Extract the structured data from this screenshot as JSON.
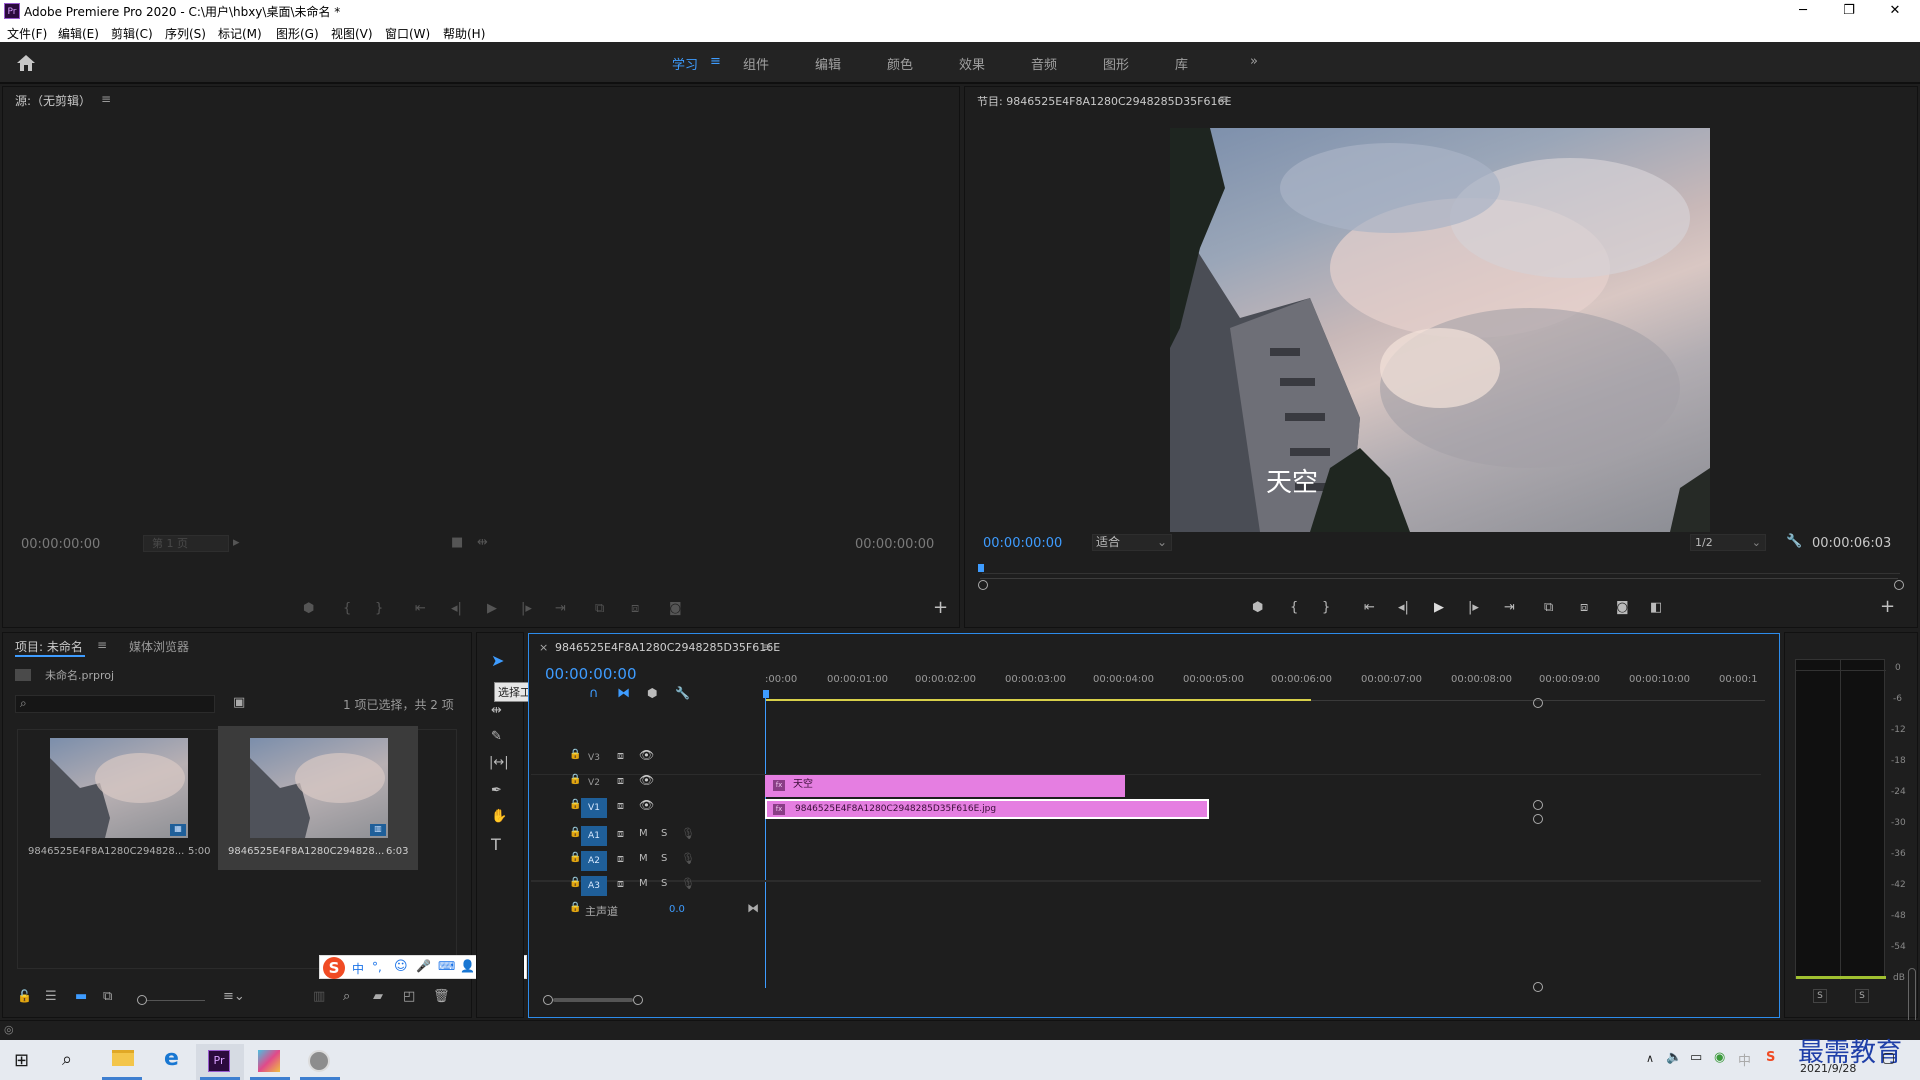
{
  "titlebar": {
    "app_icon": "Pr",
    "title": "Adobe Premiere Pro 2020 - C:\\用户\\hbxy\\桌面\\未命名 *",
    "minimize": "─",
    "restore": "❐",
    "close": "✕"
  },
  "menu": [
    "文件(F)",
    "编辑(E)",
    "剪辑(C)",
    "序列(S)",
    "标记(M)",
    "图形(G)",
    "视图(V)",
    "窗口(W)",
    "帮助(H)"
  ],
  "workspaces": {
    "tabs": [
      "学习",
      "组件",
      "编辑",
      "颜色",
      "效果",
      "音频",
      "图形",
      "库"
    ],
    "active_menu_icon": "≡",
    "overflow": "»"
  },
  "source_monitor": {
    "title": "源:（无剪辑）",
    "menu_icon": "≡",
    "timecode_left": "00:00:00:00",
    "page_select": "第 1 页",
    "timecode_right": "00:00:00:00"
  },
  "program_monitor": {
    "title": "节目: 9846525E4F8A1280C2948285D35F616E",
    "menu_icon": "≡",
    "caption": "天空",
    "timecode": "00:00:00:00",
    "fit": "适合",
    "resolution": "1/2",
    "duration": "00:00:06:03"
  },
  "project_panel": {
    "tab_project": "项目: 未命名",
    "tab_media": "媒体浏览器",
    "file": "未命名.prproj",
    "selection_info": "1 项已选择，共 2 项",
    "items": [
      {
        "name": "9846525E4F8A1280C294828...",
        "duration": "5:00"
      },
      {
        "name": "9846525E4F8A1280C294828...",
        "duration": "6:03"
      }
    ]
  },
  "tools": {
    "tooltip": "选择工具 (V)"
  },
  "ime_bar": {
    "logo": "S",
    "items": [
      "中",
      "°,",
      "☺",
      "🎤",
      "⌨",
      "👤",
      "👕",
      "▦"
    ]
  },
  "timeline": {
    "sequence_name": "9846525E4F8A1280C2948285D35F616E",
    "menu_icon": "≡",
    "close": "×",
    "timecode": "00:00:00:00",
    "ruler": [
      ":00:00",
      "00:00:01:00",
      "00:00:02:00",
      "00:00:03:00",
      "00:00:04:00",
      "00:00:05:00",
      "00:00:06:00",
      "00:00:07:00",
      "00:00:08:00",
      "00:00:09:00",
      "00:00:10:00",
      "00:00:1"
    ],
    "video_tracks": [
      "V3",
      "V2",
      "V1"
    ],
    "audio_tracks": [
      "A1",
      "A2",
      "A3"
    ],
    "mute": "M",
    "solo": "S",
    "master_label": "主声道",
    "master_value": "0.0",
    "clip_title": "天空",
    "clip_image": "9846525E4F8A1280C2948285D35F616E.jpg"
  },
  "audio_meter": {
    "scale": [
      "0",
      "-6",
      "-12",
      "-18",
      "-24",
      "-30",
      "-36",
      "-42",
      "-48",
      "-54",
      "dB"
    ],
    "solo_left": "S",
    "solo_right": "S"
  },
  "taskbar": {
    "date": "2021/9/28",
    "watermark": "最需教育"
  }
}
